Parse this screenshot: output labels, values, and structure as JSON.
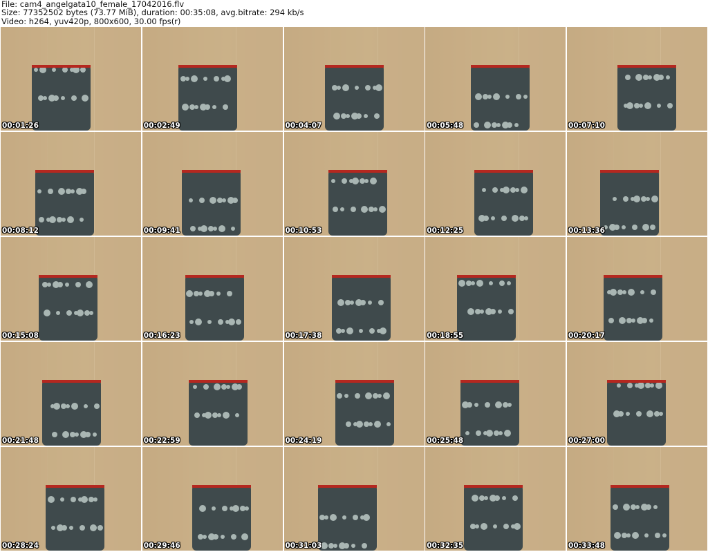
{
  "header": {
    "file_line": "File: cam4_angelgata10_female_17042016.flv",
    "size_line": "Size: 77352502 bytes (73.77 MiB), duration: 00:35:08, avg.bitrate: 294 kb/s",
    "video_line": "Video: h264, yuv420p, 800x600, 30.00 fps(r)"
  },
  "thumbnails": [
    {
      "timestamp": "00:01:26"
    },
    {
      "timestamp": "00:02:49"
    },
    {
      "timestamp": "00:04:07"
    },
    {
      "timestamp": "00:05:48"
    },
    {
      "timestamp": "00:07:10"
    },
    {
      "timestamp": "00:08:12"
    },
    {
      "timestamp": "00:09:41"
    },
    {
      "timestamp": "00:10:53"
    },
    {
      "timestamp": "00:12:25"
    },
    {
      "timestamp": "00:13:36"
    },
    {
      "timestamp": "00:15:08"
    },
    {
      "timestamp": "00:16:23"
    },
    {
      "timestamp": "00:17:38"
    },
    {
      "timestamp": "00:18:55"
    },
    {
      "timestamp": "00:20:17"
    },
    {
      "timestamp": "00:21:48"
    },
    {
      "timestamp": "00:22:59"
    },
    {
      "timestamp": "00:24:19"
    },
    {
      "timestamp": "00:25:48"
    },
    {
      "timestamp": "00:27:00"
    },
    {
      "timestamp": "00:28:24"
    },
    {
      "timestamp": "00:29:46"
    },
    {
      "timestamp": "00:31:03"
    },
    {
      "timestamp": "00:32:35"
    },
    {
      "timestamp": "00:33:48"
    }
  ],
  "colors": {
    "background": "#ffffff",
    "header_text": "#111111",
    "timestamp_text": "#ffffff",
    "timestamp_outline": "#000000",
    "wall_tone": "#c8ae86",
    "garment_dark": "#3f4a4c",
    "garment_light": "#a9b6b3",
    "trim": "#b5271f"
  }
}
